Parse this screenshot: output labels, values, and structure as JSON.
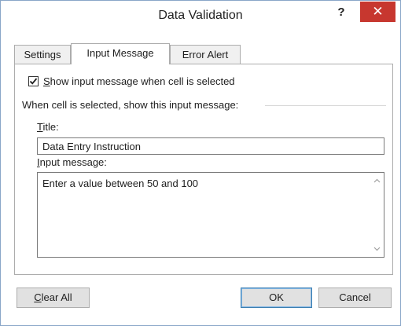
{
  "window": {
    "title": "Data Validation",
    "help_label": "?",
    "close_label": "✕"
  },
  "tabs": [
    {
      "label": "Settings",
      "active": false
    },
    {
      "label": "Input Message",
      "active": true
    },
    {
      "label": "Error Alert",
      "active": false
    }
  ],
  "input_message": {
    "show_checkbox": {
      "checked": true,
      "label_first": "S",
      "label_rest": "how input message when cell is selected"
    },
    "group_label": "When cell is selected, show this input message:",
    "title_label_first": "T",
    "title_label_rest": "itle:",
    "title_value": "Data Entry Instruction",
    "message_label_first": "I",
    "message_label_rest": "nput message:",
    "message_value": "Enter a value between 50 and 100"
  },
  "buttons": {
    "clear_all_first": "C",
    "clear_all_rest": "lear All",
    "ok": "OK",
    "cancel": "Cancel"
  },
  "colors": {
    "close_button": "#c7372f",
    "window_border": "#8aa6c8"
  }
}
